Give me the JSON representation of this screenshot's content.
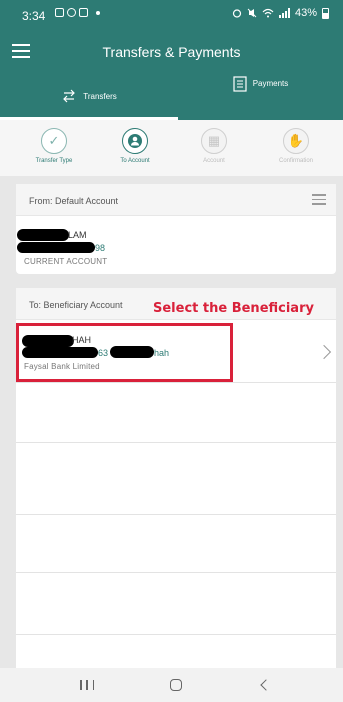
{
  "status": {
    "time": "3:34",
    "battery": "43%"
  },
  "header": {
    "title": "Transfers & Payments"
  },
  "tabs": [
    {
      "label": "Transfers",
      "icon": "transfer-arrows-icon",
      "active": true
    },
    {
      "label": "Payments",
      "icon": "receipt-icon",
      "active": false
    }
  ],
  "steps": [
    {
      "label": "Transfer Type",
      "state": "done"
    },
    {
      "label": "To Account",
      "state": "active"
    },
    {
      "label": "Account",
      "state": "todo"
    },
    {
      "label": "Confirmation",
      "state": "todo"
    }
  ],
  "from": {
    "header": "From: Default Account",
    "name_visible": "LAM",
    "number_visible": "98",
    "type": "CURRENT ACCOUNT"
  },
  "to": {
    "header": "To: Beneficiary Account",
    "annotation": "Select the Beneficiary",
    "name_visible": "HAH",
    "number_visible": "63",
    "nick_visible": "hah",
    "bank": "Faysal Bank Limited"
  },
  "colors": {
    "brand": "#2d7b74",
    "annotation": "#d9213a"
  }
}
